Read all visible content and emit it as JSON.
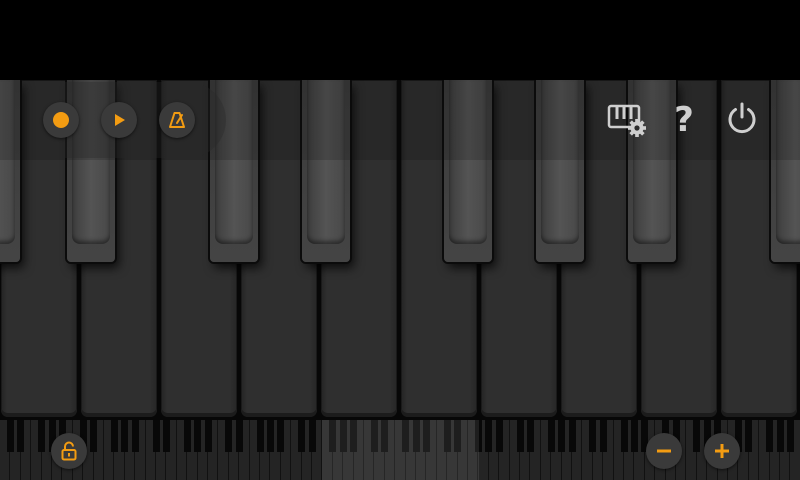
{
  "app": {
    "name": "Piano keyboard"
  },
  "colors": {
    "accent": "#f39c12",
    "icon_light": "#cfcfcf",
    "button_bg": "#3a3a3a"
  },
  "toolbar": {
    "left": [
      {
        "name": "record-button",
        "icon": "record-icon"
      },
      {
        "name": "play-button",
        "icon": "play-icon"
      },
      {
        "name": "metronome-button",
        "icon": "metronome-icon"
      }
    ],
    "right": [
      {
        "name": "keyboard-settings-button",
        "icon": "keyboard-settings-icon"
      },
      {
        "name": "help-button",
        "icon": "help-icon",
        "label": "?"
      },
      {
        "name": "power-button",
        "icon": "power-icon"
      }
    ]
  },
  "bottom_bar": {
    "lock_button": {
      "icon": "lock-open-icon"
    },
    "zoom_out_button": {
      "icon": "minus-icon"
    },
    "zoom_in_button": {
      "icon": "plus-icon"
    }
  },
  "keyboard": {
    "visible_white_keys": 10,
    "visible_black_keys": 8
  }
}
